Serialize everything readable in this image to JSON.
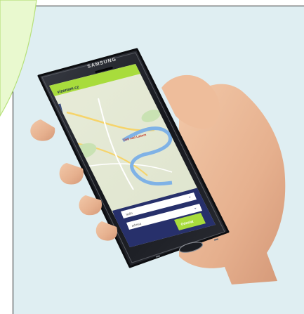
{
  "phone": {
    "brand": "SAMSUNG",
    "app_logo_text": "vizenam.cz",
    "dropdowns": [
      {
        "value": "ledlo"
      },
      {
        "value": "adresa"
      }
    ],
    "submit_label": "Odeslat",
    "map_labels": [
      "Ústí nad Labem"
    ]
  },
  "colors": {
    "background": "#dfeef2",
    "accent_green": "#a8dc3c",
    "leaf": "#e9f9cf",
    "panel_navy": "#27306b"
  }
}
